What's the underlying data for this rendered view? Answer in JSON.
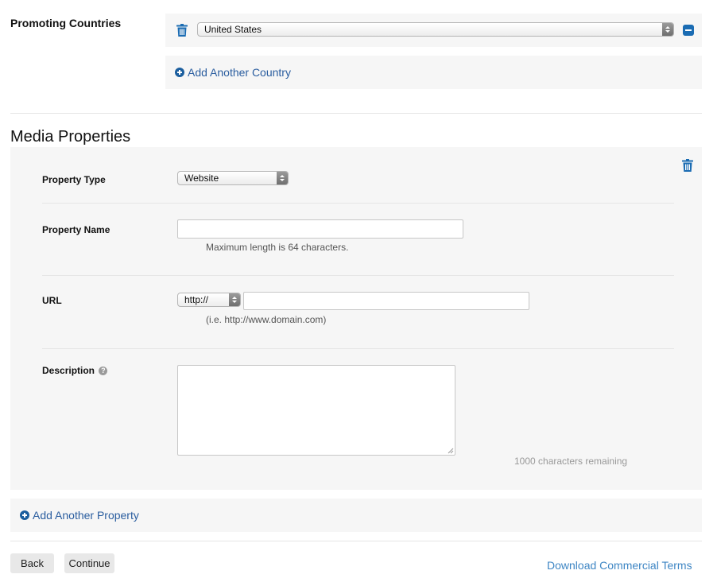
{
  "promoting_countries": {
    "label": "Promoting Countries",
    "selected_country": "United States",
    "add_label": "Add Another Country"
  },
  "media_properties": {
    "title": "Media Properties",
    "property_type": {
      "label": "Property Type",
      "value": "Website"
    },
    "property_name": {
      "label": "Property Name",
      "value": "",
      "hint": "Maximum length is 64 characters."
    },
    "url": {
      "label": "URL",
      "scheme": "http://",
      "value": "",
      "hint": "(i.e. http://www.domain.com)"
    },
    "description": {
      "label": "Description",
      "help_glyph": "?",
      "value": "",
      "remaining": "1000 characters remaining"
    },
    "add_label": "Add Another Property"
  },
  "footer": {
    "back_label": "Back",
    "continue_label": "Continue",
    "terms_label": "Download Commercial Terms"
  },
  "colors": {
    "accent": "#1b6cb3",
    "link": "#2a5d9f",
    "terms_link": "#3e86c4",
    "panel_bg": "#f6f6f6"
  },
  "icons": [
    "trash-icon",
    "minus-icon",
    "plus-circle-icon",
    "help-icon",
    "chevron-updown-icon"
  ]
}
